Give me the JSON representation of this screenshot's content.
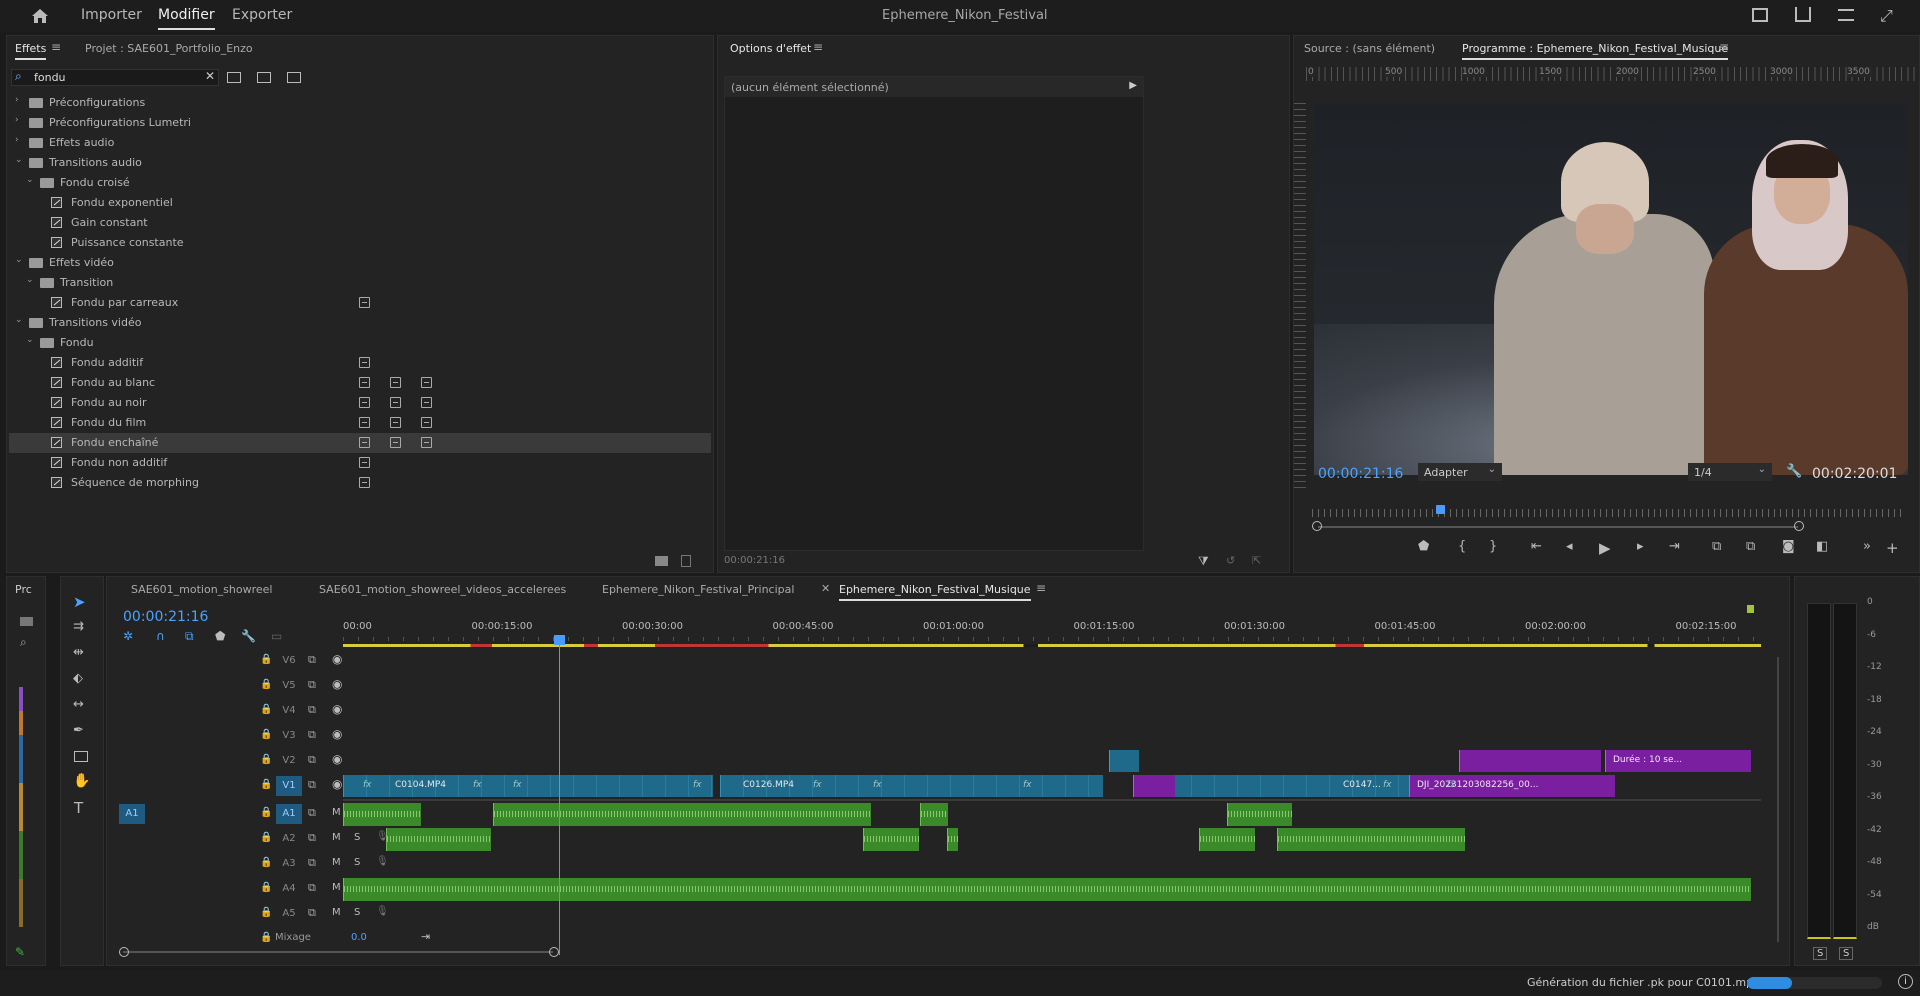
{
  "topbar": {
    "home_icon": "home-icon",
    "nav": [
      "Importer",
      "Modifier",
      "Exporter"
    ],
    "active_nav": "Modifier",
    "title": "Ephemere_Nikon_Festival"
  },
  "effects_panel": {
    "tab_effects": "Effets",
    "tab_project": "Projet : SAE601_Portfolio_Enzo",
    "search_value": "fondu",
    "tree": [
      {
        "label": "Préconfigurations",
        "level": 0,
        "type": "folder",
        "open": false
      },
      {
        "label": "Préconfigurations Lumetri",
        "level": 0,
        "type": "folder",
        "open": false
      },
      {
        "label": "Effets audio",
        "level": 0,
        "type": "folder",
        "open": false
      },
      {
        "label": "Transitions audio",
        "level": 0,
        "type": "folder",
        "open": true
      },
      {
        "label": "Fondu croisé",
        "level": 1,
        "type": "folder",
        "open": true
      },
      {
        "label": "Fondu exponentiel",
        "level": 2,
        "type": "fx",
        "badges": 0
      },
      {
        "label": "Gain constant",
        "level": 2,
        "type": "fx",
        "badges": 0
      },
      {
        "label": "Puissance constante",
        "level": 2,
        "type": "fx",
        "badges": 0
      },
      {
        "label": "Effets vidéo",
        "level": 0,
        "type": "folder",
        "open": true
      },
      {
        "label": "Transition",
        "level": 1,
        "type": "folder",
        "open": true
      },
      {
        "label": "Fondu par carreaux",
        "level": 2,
        "type": "fx",
        "badges": 1
      },
      {
        "label": "Transitions vidéo",
        "level": 0,
        "type": "folder",
        "open": true
      },
      {
        "label": "Fondu",
        "level": 1,
        "type": "folder",
        "open": true
      },
      {
        "label": "Fondu additif",
        "level": 2,
        "type": "fx",
        "badges": 1
      },
      {
        "label": "Fondu au blanc",
        "level": 2,
        "type": "fx",
        "badges": 3
      },
      {
        "label": "Fondu au noir",
        "level": 2,
        "type": "fx",
        "badges": 3
      },
      {
        "label": "Fondu du film",
        "level": 2,
        "type": "fx",
        "badges": 3
      },
      {
        "label": "Fondu enchaîné",
        "level": 2,
        "type": "fx",
        "badges": 3,
        "selected": true
      },
      {
        "label": "Fondu non additif",
        "level": 2,
        "type": "fx",
        "badges": 1
      },
      {
        "label": "Séquence de morphing",
        "level": 2,
        "type": "fx",
        "badges": 1
      }
    ]
  },
  "effect_options": {
    "tab": "Options d'effet",
    "empty_label": "(aucun élément sélectionné)",
    "timecode": "00:00:21:16"
  },
  "monitor": {
    "tab_source": "Source : (sans élément)",
    "tab_program": "Programme : Ephemere_Nikon_Festival_Musique",
    "ruler_marks": [
      "0",
      "500",
      "1000",
      "1500",
      "2000",
      "2500",
      "3000",
      "3500"
    ],
    "timecode": "00:00:21:16",
    "fit": "Adapter",
    "quality": "1/4",
    "duration": "00:02:20:01"
  },
  "timeline": {
    "side_tab": "Prc",
    "tabs": [
      "SAE601_motion_showreel",
      "SAE601_motion_showreel_videos_accelerees",
      "Ephemere_Nikon_Festival_Principal",
      "Ephemere_Nikon_Festival_Musique"
    ],
    "active_tab": "Ephemere_Nikon_Festival_Musique",
    "timecode": "00:00:21:16",
    "ruler": [
      "00:00",
      "00:00:15:00",
      "00:00:30:00",
      "00:00:45:00",
      "00:01:00:00",
      "00:01:15:00",
      "00:01:30:00",
      "00:01:45:00",
      "00:02:00:00",
      "00:02:15:00"
    ],
    "video_tracks": [
      "V6",
      "V5",
      "V4",
      "V3",
      "V2",
      "V1"
    ],
    "audio_tracks": [
      "A1",
      "A2",
      "A3",
      "A4",
      "A5"
    ],
    "source_patch": "A1",
    "mix_label": "Mixage",
    "mix_value": "0.0",
    "m_label": "M",
    "s_label": "S",
    "clips": {
      "v1_a": "C0104.MP4",
      "v1_b": "C0126.MP4",
      "v1_c": "C0147...",
      "v1_d": "DJI_20231203082256_00...",
      "v2_label": "Durée : 10 se...",
      "fx": "fx"
    }
  },
  "meter": {
    "scale": [
      "0",
      "-6",
      "-12",
      "-18",
      "-24",
      "-30",
      "-36",
      "-42",
      "-48",
      "-54",
      "dB"
    ],
    "s_left": "S",
    "s_right": "S"
  },
  "status": {
    "message": "Génération du fichier .pk pour C0101.mp4",
    "progress": 0.33
  }
}
